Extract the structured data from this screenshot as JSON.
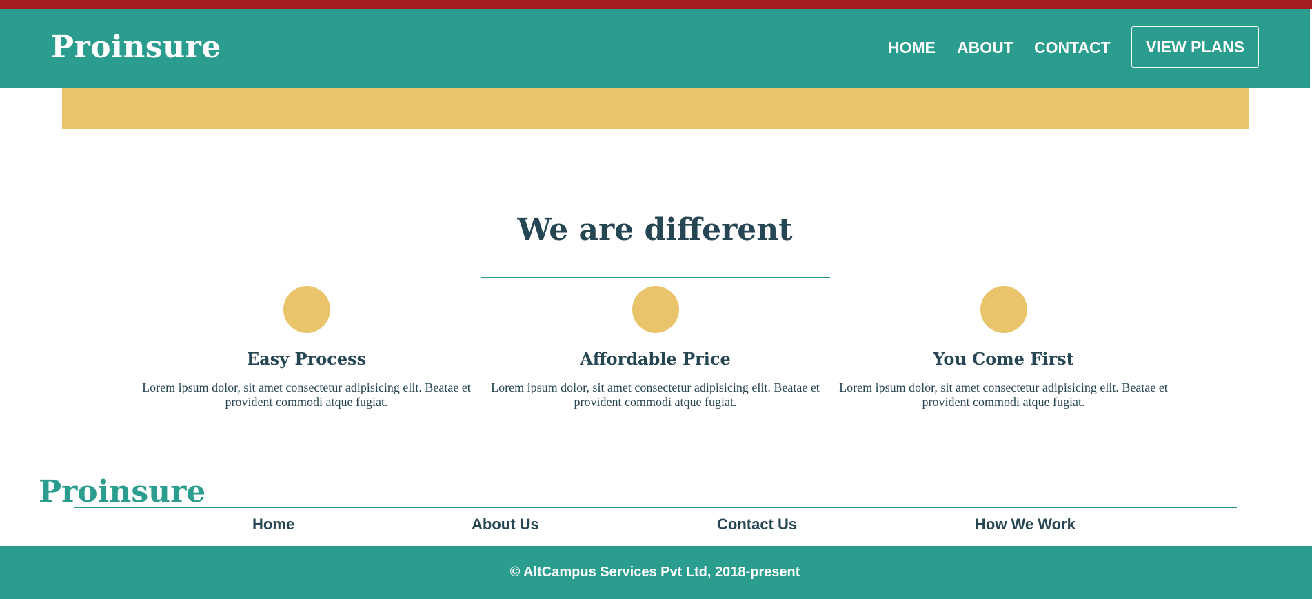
{
  "colors": {
    "top_strip": "#a51e22",
    "primary": "#2a9d8f",
    "accent": "#e9c46a",
    "text_dark": "#264653",
    "white": "#ffffff"
  },
  "header": {
    "brand": "Proinsure",
    "nav": {
      "home": "HOME",
      "about": "ABOUT",
      "contact": "CONTACT"
    },
    "cta": "VIEW PLANS"
  },
  "section": {
    "title": "We are different",
    "features": [
      {
        "icon": "circle-icon",
        "title": "Easy Process",
        "text": "Lorem ipsum dolor, sit amet consectetur adipisicing elit. Beatae et provident commodi atque fugiat."
      },
      {
        "icon": "circle-icon",
        "title": "Affordable Price",
        "text": "Lorem ipsum dolor, sit amet consectetur adipisicing elit. Beatae et provident commodi atque fugiat."
      },
      {
        "icon": "circle-icon",
        "title": "You Come First",
        "text": "Lorem ipsum dolor, sit amet consectetur adipisicing elit. Beatae et provident commodi atque fugiat."
      }
    ]
  },
  "footer": {
    "brand": "Proinsure",
    "links": {
      "home": "Home",
      "about": "About Us",
      "contact": "Contact Us",
      "work": "How We Work"
    },
    "copyright": "© AltCampus Services Pvt Ltd, 2018-present"
  }
}
